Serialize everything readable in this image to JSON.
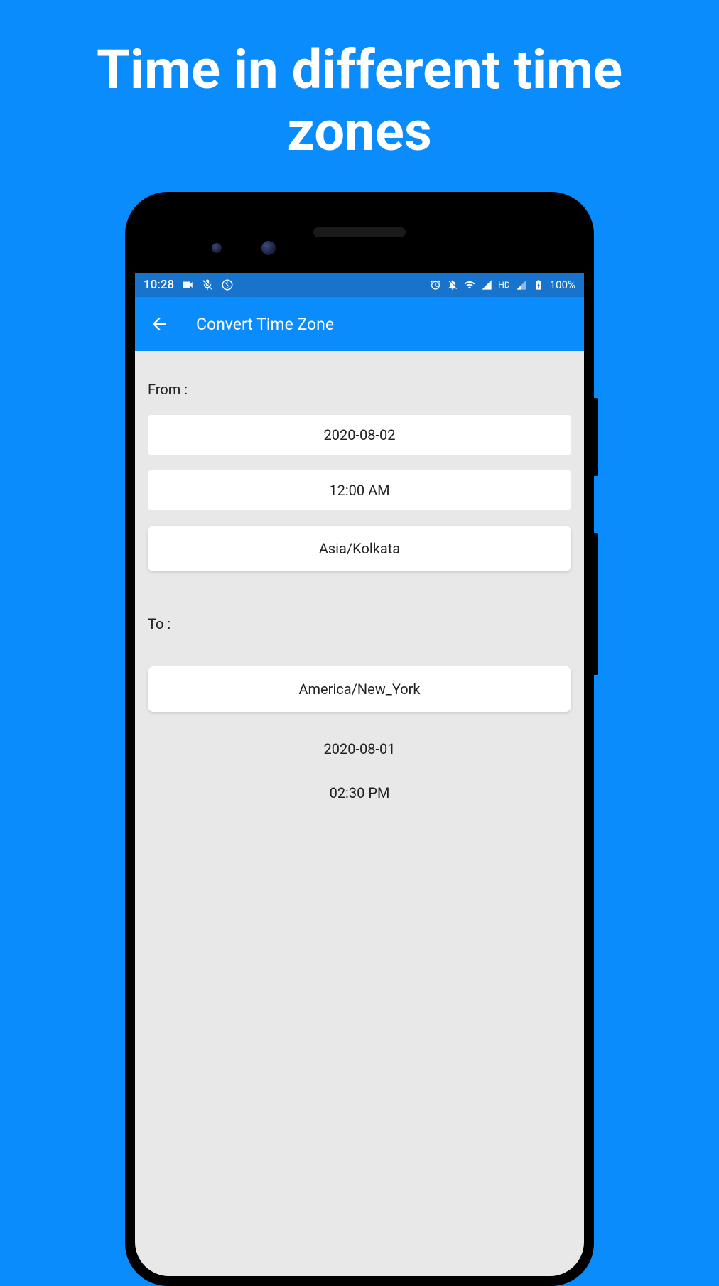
{
  "page_title": "Time in different time zones",
  "status_bar": {
    "time": "10:28",
    "battery": "100%",
    "hd_label": "HD"
  },
  "app_bar": {
    "title": "Convert Time Zone"
  },
  "from": {
    "label": "From :",
    "date": "2020-08-02",
    "time": "12:00 AM",
    "zone": "Asia/Kolkata"
  },
  "to": {
    "label": "To :",
    "zone": "America/New_York",
    "result_date": "2020-08-01",
    "result_time": "02:30 PM"
  }
}
